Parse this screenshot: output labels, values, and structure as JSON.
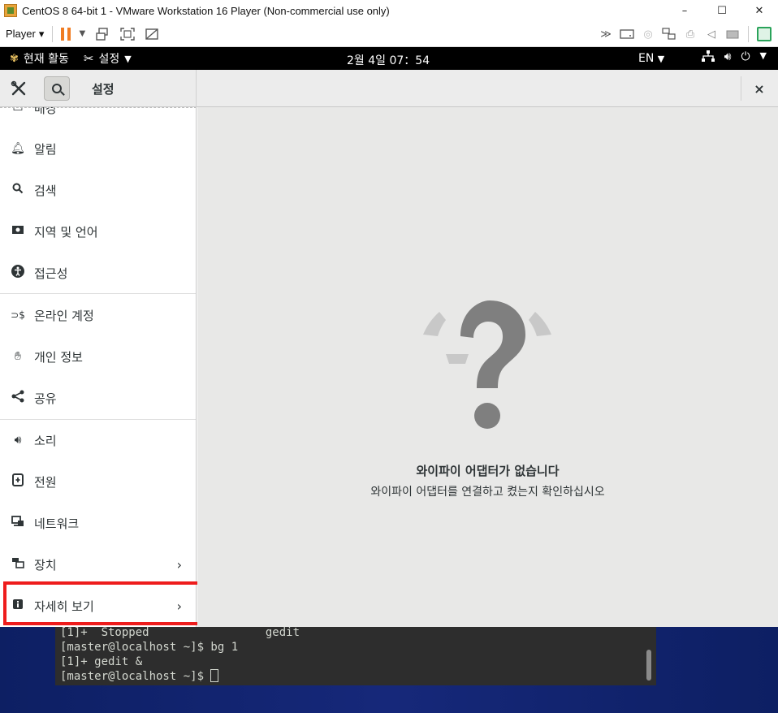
{
  "vmware": {
    "title": "CentOS 8 64-bit 1 - VMware Workstation 16 Player (Non-commercial use only)",
    "minimize": "–",
    "maximize": "☐",
    "close": "✕",
    "player_menu": "Player"
  },
  "gnome": {
    "activities": "현재 활동",
    "app_menu": "설정",
    "clock": "2월 4일 07：54",
    "lang": "EN"
  },
  "settings": {
    "title": "설정",
    "close": "×"
  },
  "sidebar": {
    "items": [
      {
        "label": "배경",
        "icon": "display-icon"
      },
      {
        "label": "알림",
        "icon": "bell-icon"
      },
      {
        "label": "검색",
        "icon": "search-icon"
      },
      {
        "label": "지역 및 언어",
        "icon": "camera-icon"
      },
      {
        "label": "접근성",
        "icon": "accessibility-icon"
      },
      {
        "label": "온라인 계정",
        "icon": "online-accounts-icon"
      },
      {
        "label": "개인 정보",
        "icon": "hand-icon"
      },
      {
        "label": "공유",
        "icon": "share-icon"
      },
      {
        "label": "소리",
        "icon": "speaker-icon"
      },
      {
        "label": "전원",
        "icon": "power-plug-icon"
      },
      {
        "label": "네트워크",
        "icon": "network-icon"
      },
      {
        "label": "장치",
        "icon": "devices-icon"
      },
      {
        "label": "자세히 보기",
        "icon": "info-icon"
      }
    ],
    "chevron": "›"
  },
  "main": {
    "title": "와이파이 어댑터가 없습니다",
    "subtitle": "와이파이 어댑터를 연결하고 켰는지 확인하십시오"
  },
  "terminal": {
    "lines": [
      "[1]+  Stopped                 gedit",
      "[master@localhost ~]$ bg 1",
      "[1]+ gedit &",
      "[master@localhost ~]$ "
    ]
  }
}
